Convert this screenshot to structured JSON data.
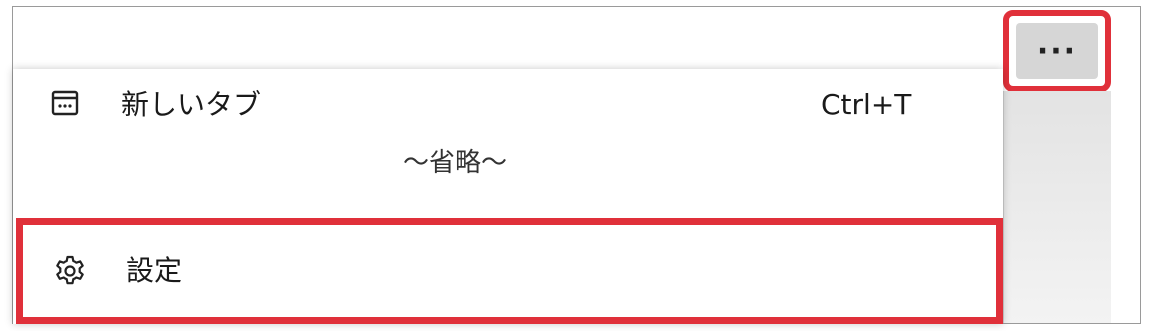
{
  "toolbar": {
    "more_button_label": "···"
  },
  "menu": {
    "new_tab": {
      "label": "新しいタブ",
      "shortcut": "Ctrl+T",
      "icon": "new-tab-icon"
    },
    "omission_text": "～省略～",
    "settings": {
      "label": "設定",
      "icon": "gear-icon"
    }
  },
  "colors": {
    "highlight": "#e0303a",
    "button_bg": "#d6d6d6",
    "frame_border": "#9a9a9a"
  }
}
